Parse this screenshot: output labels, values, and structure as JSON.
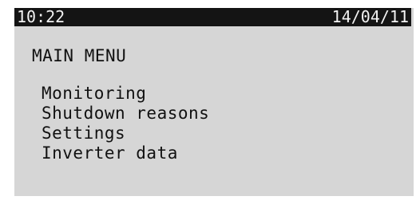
{
  "status_bar": {
    "time": "10:22",
    "date": "14/04/11"
  },
  "menu": {
    "title": "MAIN MENU",
    "items": [
      {
        "label": "Monitoring"
      },
      {
        "label": "Shutdown reasons"
      },
      {
        "label": "Settings"
      },
      {
        "label": "Inverter data"
      }
    ]
  },
  "colors": {
    "screen_background": "#d6d6d6",
    "status_bar_background": "#141414",
    "status_bar_text": "#f2f2f2",
    "text": "#111111"
  }
}
